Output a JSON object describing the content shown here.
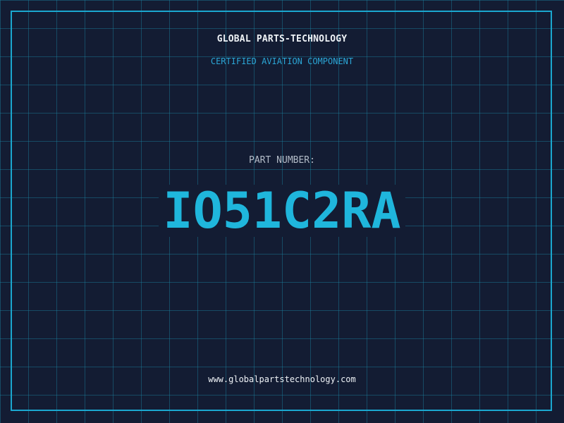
{
  "header": {
    "company": "GLOBAL PARTS-TECHNOLOGY",
    "subtitle": "CERTIFIED AVIATION COMPONENT"
  },
  "main": {
    "part_label": "PART NUMBER:",
    "part_number": "IO51C2RA"
  },
  "footer": {
    "url": "www.globalpartstechnology.com"
  },
  "colors": {
    "background": "#131c33",
    "grid": "#1c82a0",
    "accent": "#1fb6dc",
    "text": "#eef2f6",
    "muted": "#b3bcc8"
  }
}
